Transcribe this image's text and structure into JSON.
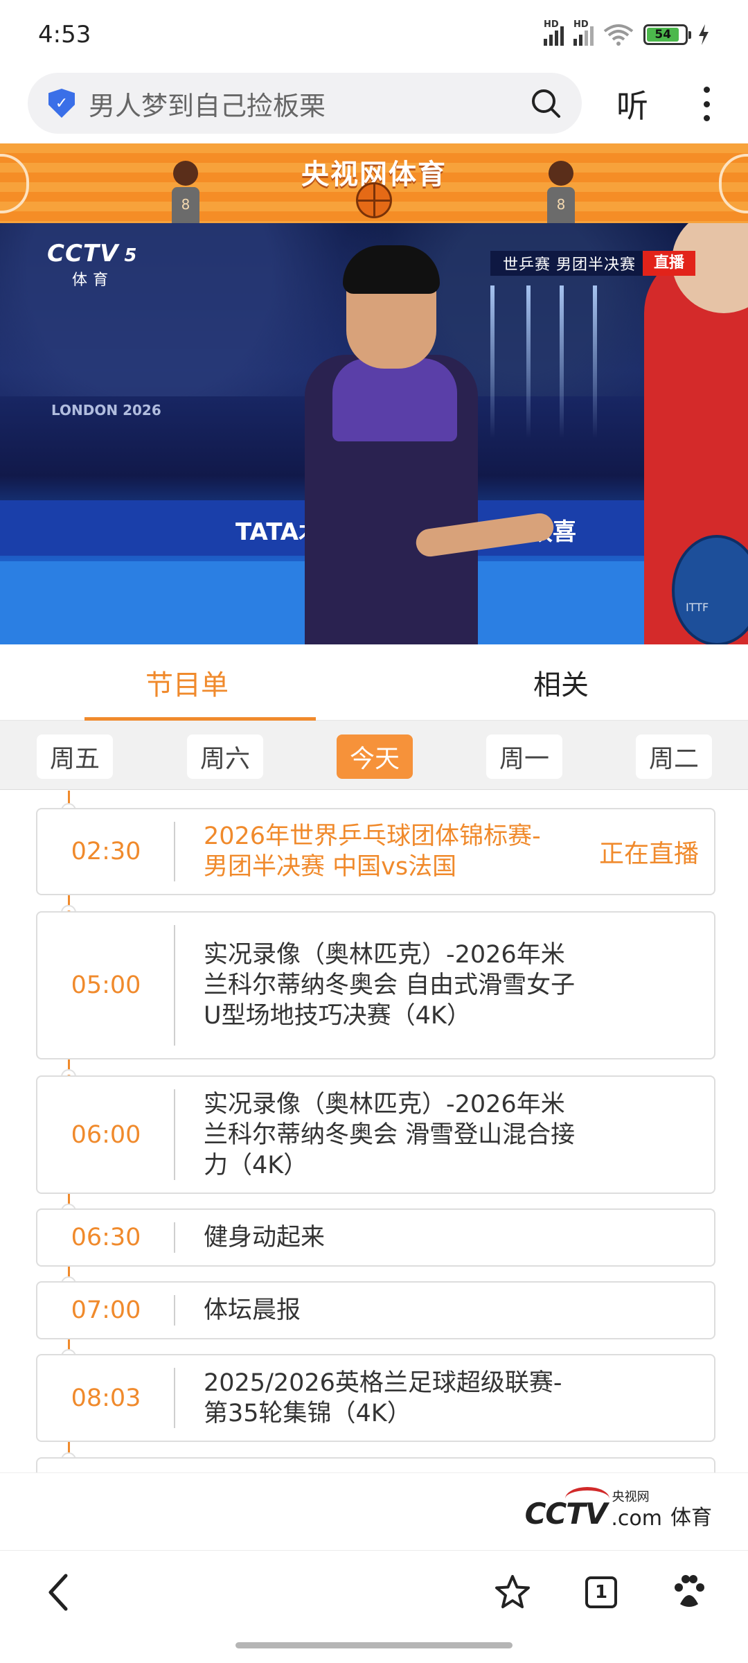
{
  "status_bar": {
    "time": "4:53",
    "battery": "54",
    "signal_1": "HD",
    "signal_2": "HD"
  },
  "browser": {
    "search_text": "男人梦到自己捡板栗",
    "listen_label": "听"
  },
  "banner": {
    "title": "央视网体育",
    "jersey_left": "8",
    "jersey_right": "8"
  },
  "video": {
    "channel_logo": "CCTV",
    "channel_number": "5",
    "channel_name": "体育",
    "event_tag": "世乒赛  男团半决赛",
    "live_label": "直播",
    "venue_text": "LONDON 2026",
    "board_text_1": "TATA木门",
    "board_text_2": "红双喜"
  },
  "tabs": [
    {
      "label": "节目单"
    },
    {
      "label": "相关"
    }
  ],
  "days": [
    {
      "label": "周五"
    },
    {
      "label": "周六"
    },
    {
      "label": "今天"
    },
    {
      "label": "周一"
    },
    {
      "label": "周二"
    }
  ],
  "schedule": [
    {
      "time": "02:30",
      "title": "2026年世界乒乓球团体锦标赛-男团半决赛 中国vs法国",
      "status": "正在直播"
    },
    {
      "time": "05:00",
      "title": "实况录像（奥林匹克）-2026年米兰科尔蒂纳冬奥会 自由式滑雪女子U型场地技巧决赛（4K）"
    },
    {
      "time": "06:00",
      "title": "实况录像（奥林匹克）-2026年米兰科尔蒂纳冬奥会 滑雪登山混合接力（4K）"
    },
    {
      "time": "06:30",
      "title": "健身动起来"
    },
    {
      "time": "07:00",
      "title": "体坛晨报"
    },
    {
      "time": "08:03",
      "title": "2025/2026英格兰足球超级联赛-第35轮集锦（4K）"
    }
  ],
  "footer": {
    "logo_main": "CCTV",
    "logo_com": ".com",
    "logo_small": "央视网",
    "logo_sport": "体育"
  },
  "bottom_nav": {
    "tab_count": "1"
  },
  "colors": {
    "accent": "#f08a2c",
    "live_red": "#e2231a",
    "banner_orange": "#f7a23b"
  },
  "icons": [
    "shield-icon",
    "search-icon",
    "more-icon",
    "back-icon",
    "star-icon",
    "tabs-icon",
    "baidu-icon"
  ]
}
